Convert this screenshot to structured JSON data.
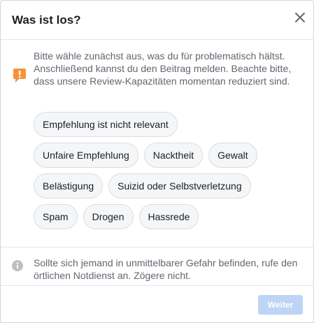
{
  "dialog": {
    "title": "Was ist los?",
    "close_icon": "close-icon"
  },
  "intro": {
    "icon": "warning-icon",
    "icon_color": "#f7923b",
    "text": "Bitte wähle zunächst aus, was du für problematisch hältst. Anschließend kannst du den Beitrag melden. Beachte bitte, dass unsere Review-Kapazitäten momentan reduziert sind."
  },
  "options": {
    "rows": [
      [
        "Empfehlung ist nicht relevant"
      ],
      [
        "Unfaire Empfehlung",
        "Nacktheit",
        "Gewalt"
      ],
      [
        "Belästigung",
        "Suizid oder Selbstverletzung"
      ],
      [
        "Spam",
        "Drogen",
        "Hassrede"
      ]
    ]
  },
  "notice": {
    "icon": "info-icon",
    "text": "Sollte sich jemand in unmittelbarer Gefahr befinden, rufe den örtlichen Notdienst an. Zögere nicht."
  },
  "footer": {
    "submit_label": "Weiter",
    "submit_color": "#bed4f5"
  }
}
